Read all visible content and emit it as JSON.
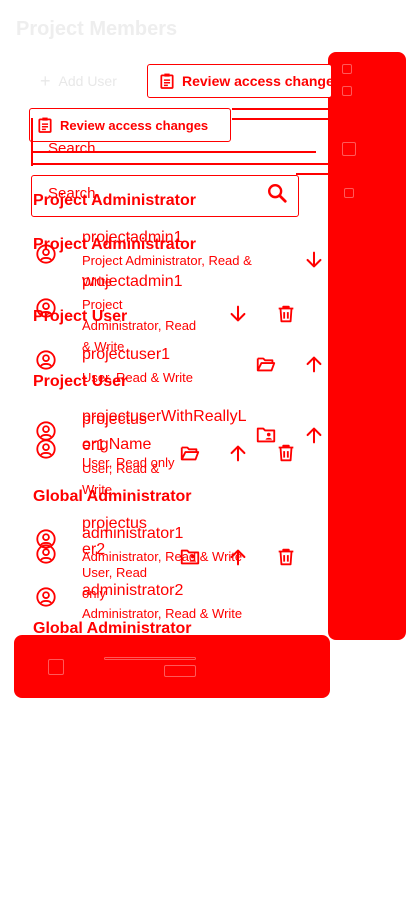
{
  "page": {
    "title": "Project Members"
  },
  "toolbar": {
    "add_user_label": "Add User",
    "review_label": "Review access changes"
  },
  "search": {
    "label": "Search"
  },
  "groups": [
    {
      "title": "Project Administrator"
    },
    {
      "title": "Project User"
    },
    {
      "title": "Global Administrator"
    }
  ],
  "members": [
    {
      "name": "projectadmin1",
      "role": "Project Administrator, Read & Write"
    },
    {
      "name": "projectuser1",
      "role": "User, Read & Write"
    },
    {
      "name": "projectuserWithReallyLongName",
      "role": "User, Read only"
    },
    {
      "name": "administrator1",
      "role": "Administrator, Read & Write"
    },
    {
      "name": "administrator2",
      "role": "Administrator, Read & Write"
    }
  ],
  "ghost_layer": {
    "review_label": "Review access changes",
    "search_label": "Search",
    "admin_title": "Project Administrator",
    "admin_name": "projectadmin1",
    "admin_role_lines": [
      "Project",
      "Administrator, Read",
      "& Write"
    ],
    "user_title": "Project User",
    "user1_name_lines": [
      "projectus",
      "er1"
    ],
    "user1_role_lines": [
      "User, Read &",
      "Write"
    ],
    "user2_name_lines": [
      "projectus",
      "er2"
    ],
    "user2_role_lines": [
      "User, Read",
      "only"
    ],
    "global_title": "Global Administrator"
  },
  "icons": {
    "clipboard": "clipboard-icon",
    "search": "search-icon",
    "avatar": "account-circle-icon",
    "arrow_down": "arrow-down-icon",
    "arrow_up": "arrow-up-icon",
    "delete": "trash-icon",
    "folder_open": "folder-open-icon",
    "folder_shared": "folder-account-icon"
  },
  "colors": {
    "accent": "#ff0000",
    "faded_text": "#eeeeee",
    "background": "#ffffff"
  }
}
